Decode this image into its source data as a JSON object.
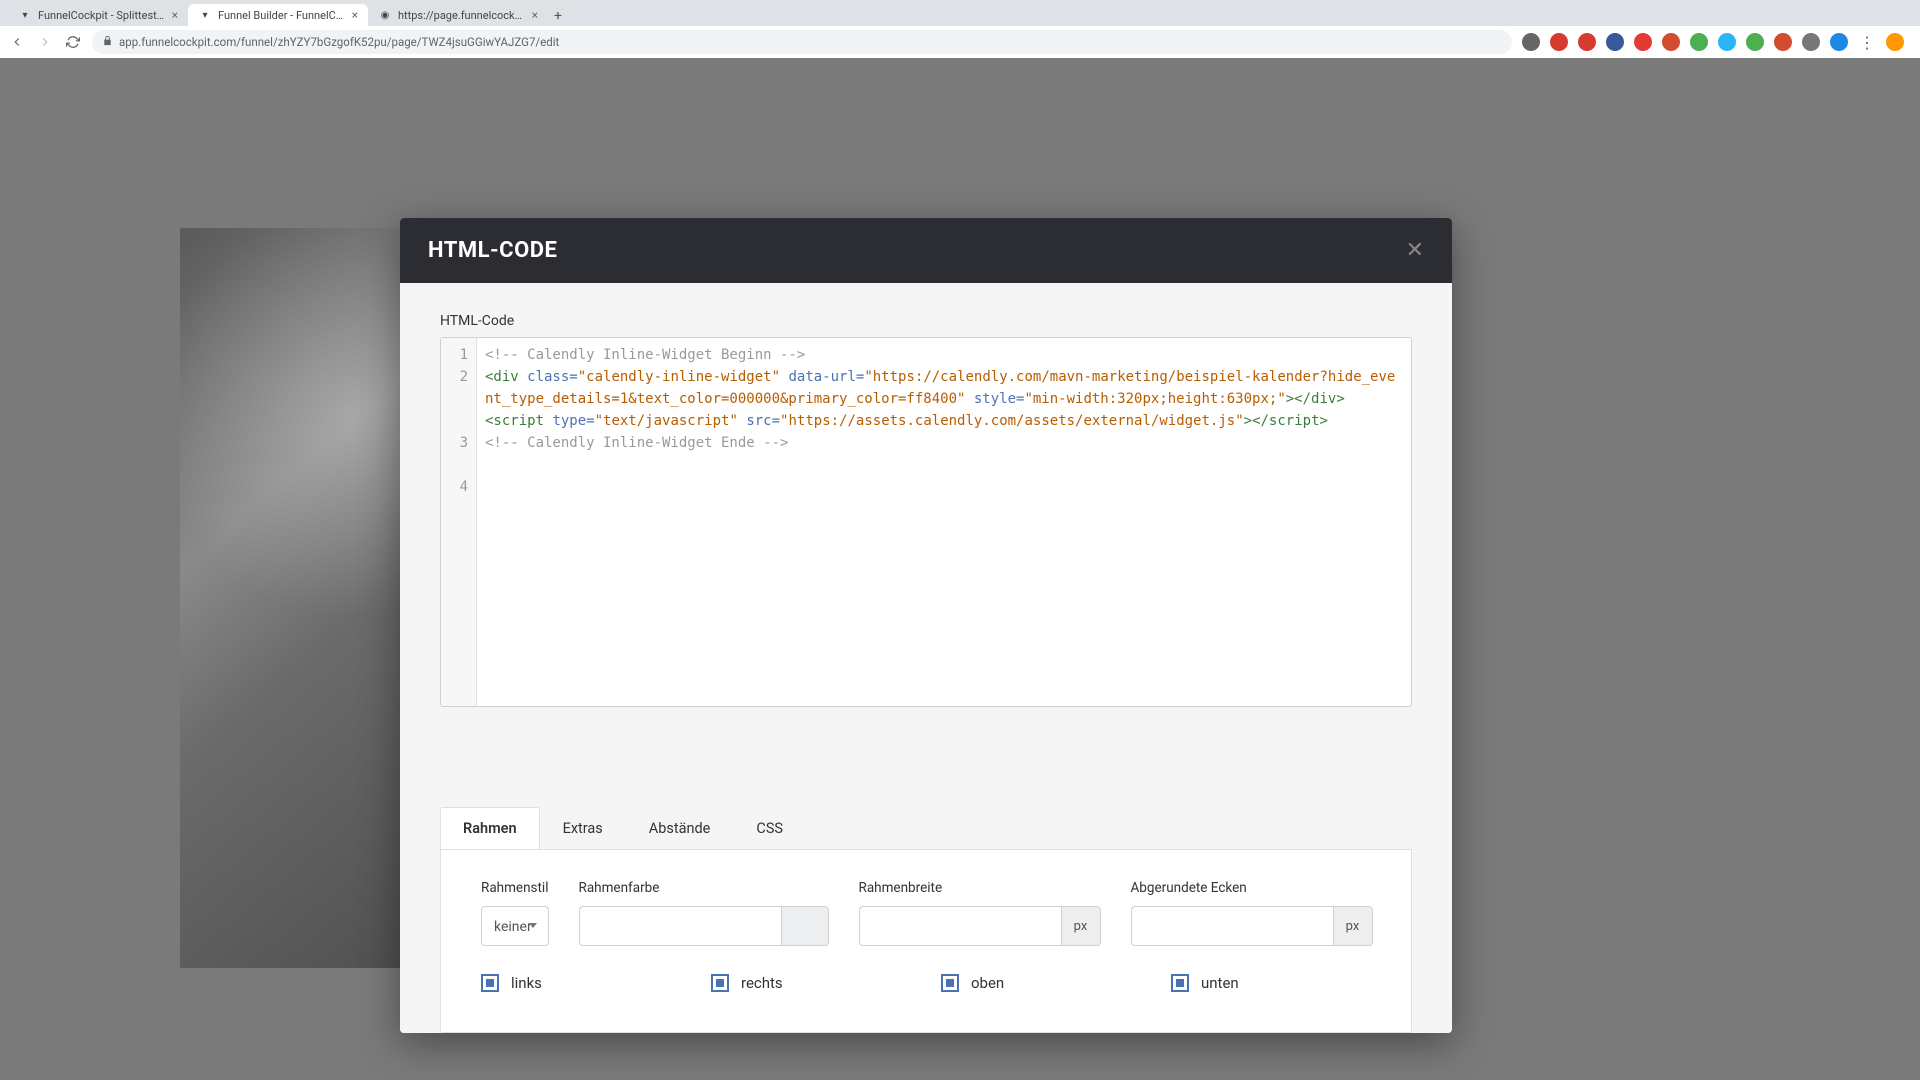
{
  "browser": {
    "tabs": [
      {
        "title": "FunnelCockpit - Splittests, Ma",
        "active": false
      },
      {
        "title": "Funnel Builder - FunnelCockpit",
        "active": true
      },
      {
        "title": "https://page.funnelcockpit.co",
        "active": false
      }
    ],
    "url": "app.funnelcockpit.com/funnel/zhYZY7bGzgofK52pu/page/TWZ4jsuGGiwYAJZG7/edit"
  },
  "modal": {
    "title": "HTML-CODE",
    "section_label": "HTML-Code",
    "code": {
      "line_numbers": [
        "1",
        "2",
        "3",
        "4"
      ],
      "lines": {
        "l1_comment": "<!-- Calendly Inline-Widget Beginn -->",
        "l2_open": "<div",
        "l2_attr_class": " class=",
        "l2_val_class": "\"calendly-inline-widget\"",
        "l2_attr_dataurl": " data-url=",
        "l2_val_dataurl": "\"https://calendly.com/mavn-marketing/beispiel-kalender?hide_event_type_details=1&text_color=000000&primary_color=ff8400\"",
        "l2_attr_style": " style=",
        "l2_val_style": "\"min-width:320px;height:630px;\"",
        "l2_close": "></div>",
        "l3_open": "<script",
        "l3_attr_type": " type=",
        "l3_val_type": "\"text/javascript\"",
        "l3_attr_src": " src=",
        "l3_val_src": "\"https://assets.calendly.com/assets/external/widget.js\"",
        "l3_mid": ">",
        "l3_close": "</script>",
        "l4_comment": "<!-- Calendly Inline-Widget Ende -->"
      }
    },
    "tabs": {
      "rahmen": "Rahmen",
      "extras": "Extras",
      "abstaende": "Abstände",
      "css": "CSS"
    },
    "form": {
      "rahmenstil_label": "Rahmenstil",
      "rahmenstil_value": "keiner",
      "rahmenfarbe_label": "Rahmenfarbe",
      "rahmenfarbe_value": "",
      "rahmenbreite_label": "Rahmenbreite",
      "rahmenbreite_value": "",
      "rahmenbreite_unit": "px",
      "ecken_label": "Abgerundete Ecken",
      "ecken_value": "",
      "ecken_unit": "px",
      "cb_links": "links",
      "cb_rechts": "rechts",
      "cb_oben": "oben",
      "cb_unten": "unten"
    }
  },
  "colors": {
    "ext": [
      "#666",
      "#d63b2f",
      "#d63b2f",
      "#3b5998",
      "#e53935",
      "#d34c2e",
      "#4caf50",
      "#29b6f6",
      "#4caf50",
      "#d34c2e",
      "#777",
      "#1e88e5",
      "#777",
      "#ff9800"
    ]
  }
}
